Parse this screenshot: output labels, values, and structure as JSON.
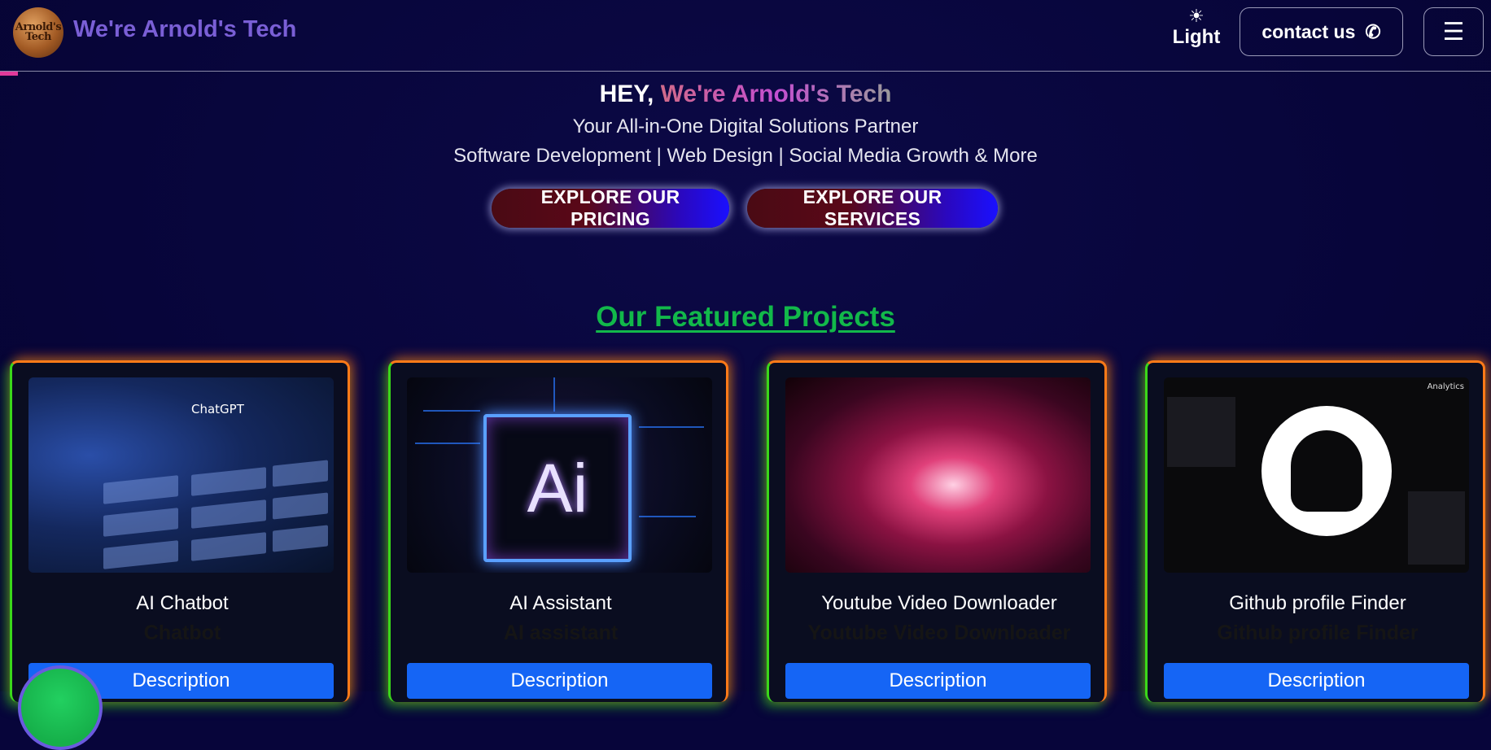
{
  "header": {
    "logo_text": "Arnold's Tech",
    "brand": "We're Arnold's Tech",
    "theme_label": "Light",
    "contact_label": "contact us",
    "menu_icon": "hamburger-icon"
  },
  "hero": {
    "hey": "HEY,",
    "name": "We're Arnold's Tech",
    "subtitle1": "Your All-in-One Digital Solutions Partner",
    "subtitle2": "Software Development | Web Design | Social Media Growth & More",
    "btn_pricing": "EXPLORE OUR PRICING",
    "btn_services": "EXPLORE OUR SERVICES"
  },
  "featured": {
    "title": "Our Featured Projects",
    "cards": [
      {
        "title": "AI Chatbot",
        "subtitle": "Chatbot",
        "button": "Description",
        "image_text": "ChatGPT"
      },
      {
        "title": "AI Assistant",
        "subtitle": "AI assistant",
        "button": "Description",
        "image_text": "Ai"
      },
      {
        "title": "Youtube Video Downloader",
        "subtitle": "Youtube Video Downloader",
        "button": "Description"
      },
      {
        "title": "Github profile Finder",
        "subtitle": "Github profile Finder",
        "button": "Description",
        "image_text": "Analytics"
      }
    ]
  },
  "colors": {
    "background": "#07053a",
    "brand": "#7a5fd6",
    "featured_title": "#12b84a",
    "button_blue": "#1565f5",
    "card_border_orange": "#ff7a18",
    "card_border_green": "#3ad81a"
  }
}
